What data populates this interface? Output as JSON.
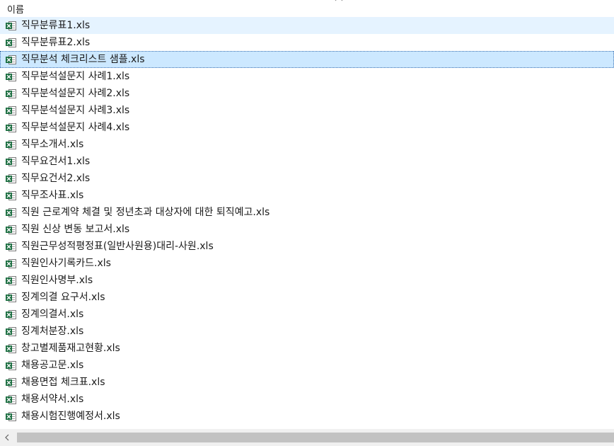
{
  "header": {
    "name_label": "이름"
  },
  "files": [
    {
      "name": "직무분류표1.xls",
      "state": "hovered"
    },
    {
      "name": "직무분류표2.xls",
      "state": ""
    },
    {
      "name": "직무분석 체크리스트 샘플.xls",
      "state": "selected"
    },
    {
      "name": "직무분석설문지 사례1.xls",
      "state": ""
    },
    {
      "name": "직무분석설문지 사례2.xls",
      "state": ""
    },
    {
      "name": "직무분석설문지 사례3.xls",
      "state": ""
    },
    {
      "name": "직무분석설문지 사례4.xls",
      "state": ""
    },
    {
      "name": "직무소개서.xls",
      "state": ""
    },
    {
      "name": "직무요건서1.xls",
      "state": ""
    },
    {
      "name": "직무요건서2.xls",
      "state": ""
    },
    {
      "name": "직무조사표.xls",
      "state": ""
    },
    {
      "name": "직원 근로계약 체결 및 정년초과 대상자에 대한 퇴직예고.xls",
      "state": ""
    },
    {
      "name": "직원 신상 변동 보고서.xls",
      "state": ""
    },
    {
      "name": "직원근무성적평정표(일반사원용)대리-사원.xls",
      "state": ""
    },
    {
      "name": "직원인사기록카드.xls",
      "state": ""
    },
    {
      "name": "직원인사명부.xls",
      "state": ""
    },
    {
      "name": "징계의결 요구서.xls",
      "state": ""
    },
    {
      "name": "징계의결서.xls",
      "state": ""
    },
    {
      "name": "징계처분장.xls",
      "state": ""
    },
    {
      "name": "창고별제품재고현황.xls",
      "state": ""
    },
    {
      "name": "채용공고문.xls",
      "state": ""
    },
    {
      "name": "채용면접 체크표.xls",
      "state": ""
    },
    {
      "name": "채용서약서.xls",
      "state": ""
    },
    {
      "name": "채용시험진행예정서.xls",
      "state": ""
    },
    {
      "name": "",
      "state": "partial"
    }
  ],
  "icons": {
    "file": "excel-file-icon",
    "sort": "sort-up-icon",
    "scroll_left": "chevron-left-icon"
  },
  "colors": {
    "excel_green": "#1d6f42",
    "hover_bg": "#e5f3ff",
    "selected_bg": "#cce8ff"
  }
}
